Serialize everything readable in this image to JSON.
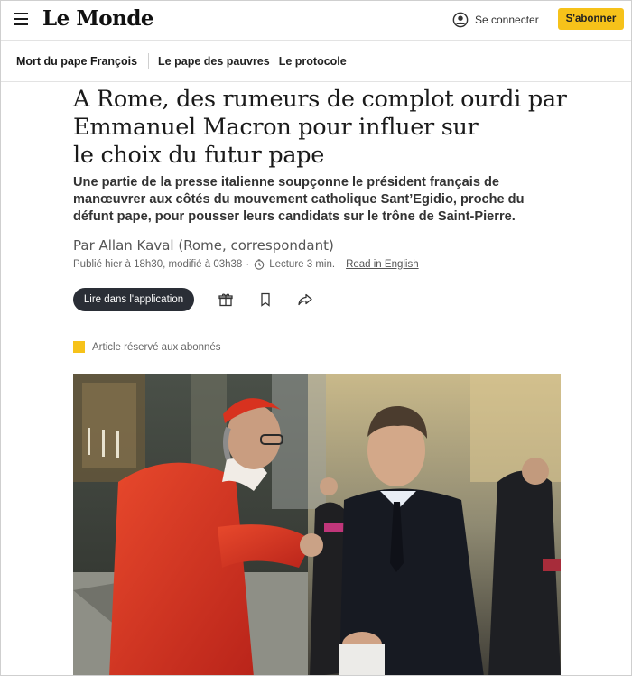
{
  "header": {
    "logo": "Le Monde",
    "login_label": "Se connecter",
    "subscribe_label": "S'abonner"
  },
  "subnav": {
    "main": "Mort du pape François",
    "items": [
      "Le pape des pauvres",
      "Le protocole"
    ]
  },
  "article": {
    "title_lines": [
      "A Rome, des rumeurs de complot ourdi par",
      "Emmanuel Macron pour influer sur",
      "le choix du futur pape"
    ],
    "standfirst_lines": [
      "Une partie de la presse italienne soupçonne le président français de",
      "manœuvrer aux côtés du mouvement catholique Sant’Egidio, proche du",
      "défunt pape, pour pousser leurs candidats sur le trône de Saint-Pierre."
    ],
    "byline": "Par Allan Kaval (Rome, correspondant)",
    "published": "Publié hier à 18h30, modifié à 03h38",
    "dot": "·",
    "reading_time": "Lecture 3 min.",
    "read_in_english": "Read in English",
    "app_button": "Lire dans l'application",
    "reserved_badge": "",
    "reserved_label": "Article réservé aux abonnés"
  },
  "colors": {
    "accent_yellow": "#f6c21a",
    "button_dark": "#2a2e36",
    "cardinal_red": "#d8321f"
  },
  "icons": [
    "menu-icon",
    "user-icon",
    "clock-icon",
    "gift-icon",
    "bookmark-icon",
    "share-icon"
  ]
}
